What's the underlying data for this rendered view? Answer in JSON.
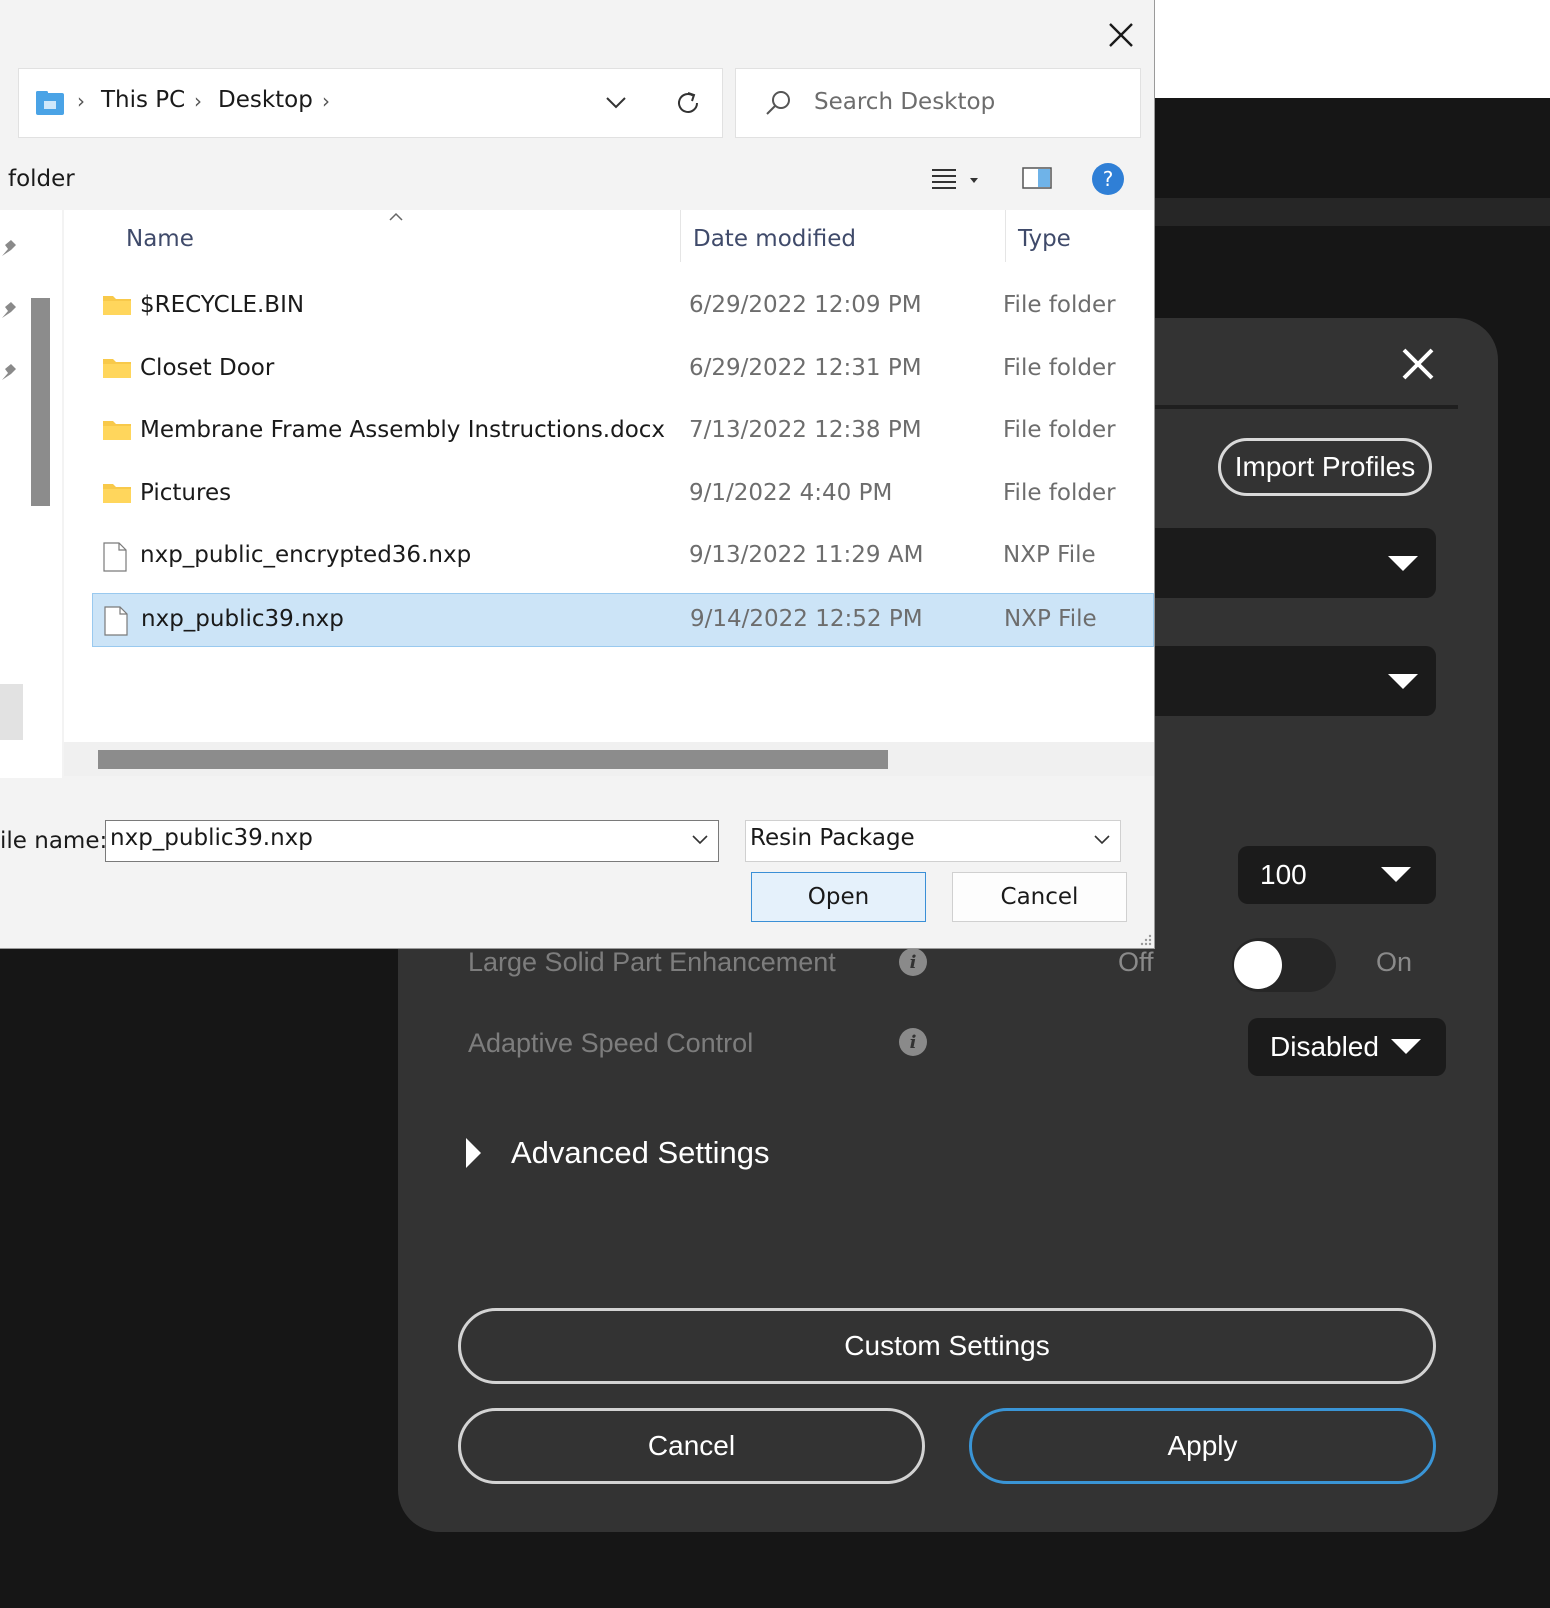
{
  "app": {
    "import_profiles_label": "Import Profiles",
    "resolution_value": "100",
    "large_solid_label": "Large Solid Part Enhancement",
    "toggle_off": "Off",
    "toggle_on": "On",
    "toggle_state": "off",
    "adaptive_speed_label": "Adaptive Speed Control",
    "adaptive_speed_value": "Disabled",
    "advanced_settings_label": "Advanced Settings",
    "custom_settings_label": "Custom Settings",
    "cancel_label": "Cancel",
    "apply_label": "Apply",
    "info_glyph": "i"
  },
  "dialog": {
    "breadcrumb": [
      "This PC",
      "Desktop"
    ],
    "search_placeholder": "Search Desktop",
    "toolbar_left_text": "folder",
    "help_glyph": "?",
    "columns": {
      "name": "Name",
      "date": "Date modified",
      "type": "Type"
    },
    "files": [
      {
        "name": "$RECYCLE.BIN",
        "date": "6/29/2022 12:09 PM",
        "type": "File folder",
        "icon": "folder-icon",
        "selected": false
      },
      {
        "name": "Closet Door",
        "date": "6/29/2022 12:31 PM",
        "type": "File folder",
        "icon": "folder-icon",
        "selected": false
      },
      {
        "name": "Membrane Frame Assembly Instructions.docx",
        "date": "7/13/2022 12:38 PM",
        "type": "File folder",
        "icon": "folder-icon",
        "selected": false
      },
      {
        "name": "Pictures",
        "date": "9/1/2022 4:40 PM",
        "type": "File folder",
        "icon": "folder-icon",
        "selected": false
      },
      {
        "name": "nxp_public_encrypted36.nxp",
        "date": "9/13/2022 11:29 AM",
        "type": "NXP File",
        "icon": "file-icon",
        "selected": false
      },
      {
        "name": "nxp_public39.nxp",
        "date": "9/14/2022 12:52 PM",
        "type": "NXP File",
        "icon": "file-icon",
        "selected": true
      }
    ],
    "filename_label": "ile name:",
    "filename_value": "nxp_public39.nxp",
    "filter_value": "Resin Package",
    "open_label": "Open",
    "cancel_label": "Cancel"
  },
  "colors": {
    "accent_blue": "#3a95d6",
    "selection_bg": "#cce4f7",
    "panel_bg": "#333333",
    "folder_yellow": "#f8c94a"
  }
}
